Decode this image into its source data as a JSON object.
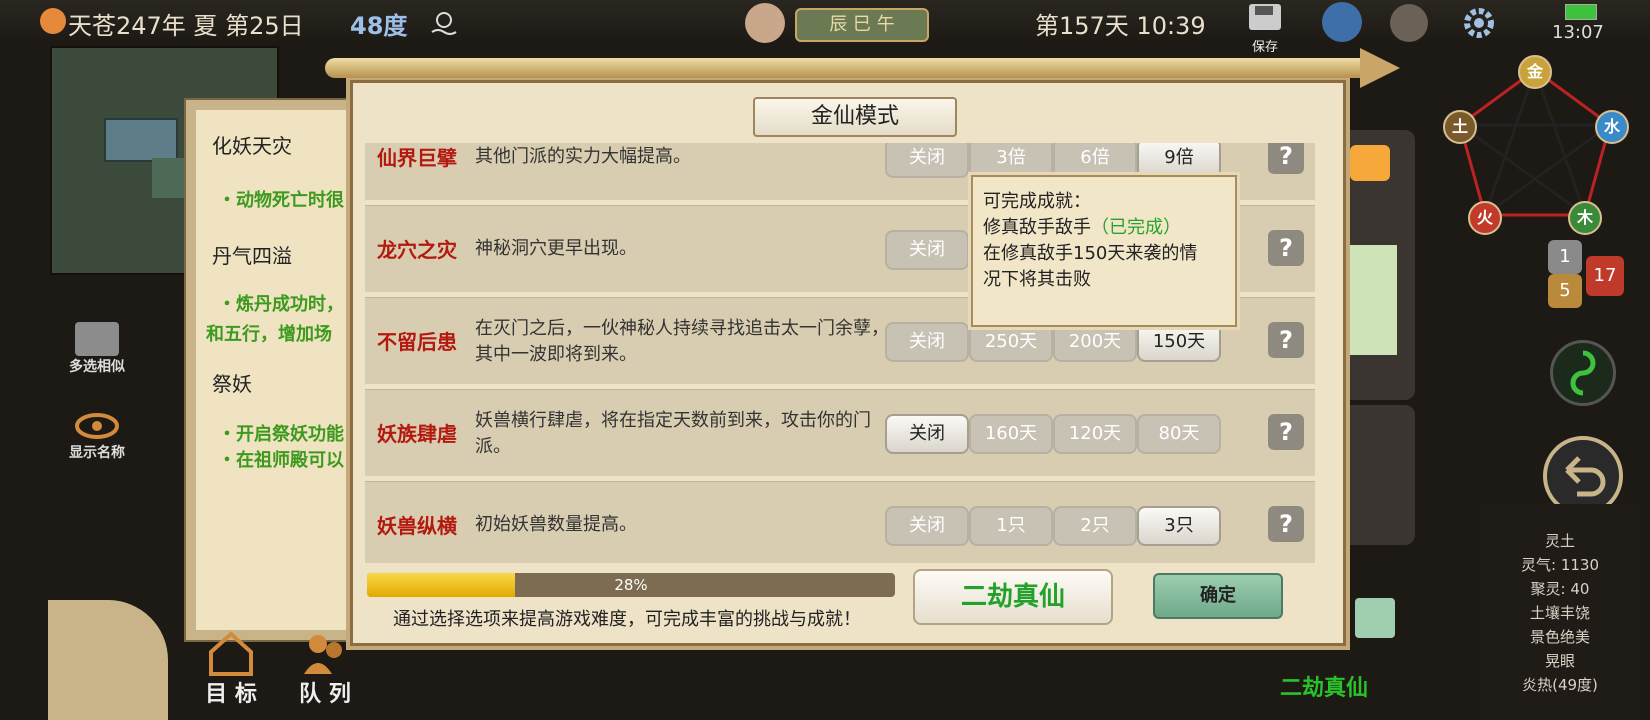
{
  "topbar": {
    "date": "天苍247年 夏 第25日",
    "temperature": "48度",
    "time_of_day": "辰 巳 午",
    "day_time": "第157天 10:39",
    "save_label": "保存",
    "clock": "13:07"
  },
  "left_panel": {
    "sections": [
      {
        "title": "化妖天灾",
        "lines": [
          "・动物死亡时很"
        ]
      },
      {
        "title": "丹气四溢",
        "lines": [
          "・炼丹成功时，",
          "和五行，增加场"
        ]
      },
      {
        "title": "祭妖",
        "lines": [
          "・开启祭妖功能",
          "・在祖师殿可以"
        ]
      }
    ]
  },
  "side_buttons": {
    "multi_select": "多选相似",
    "show_names": "显示名称",
    "goal": "目 标",
    "queue": "队 列"
  },
  "wuxing": {
    "metal": "金",
    "water": "水",
    "wood": "木",
    "fire": "火",
    "earth": "土"
  },
  "badges": {
    "one": "1",
    "five": "5",
    "seventeen": "17"
  },
  "stats": {
    "title": "灵土",
    "lines": [
      "灵气: 1130",
      "聚灵: 40",
      "土壤丰饶",
      "景色绝美",
      "晃眼",
      "炎热(49度)"
    ]
  },
  "bottom_rank_label": "二劫真仙",
  "dialog": {
    "title": "金仙模式",
    "rows": [
      {
        "name": "仙界巨擘",
        "desc": "其他门派的实力大幅提高。",
        "options": [
          "关闭",
          "3倍",
          "6倍",
          "9倍"
        ],
        "selected": 3
      },
      {
        "name": "龙穴之灾",
        "desc": "神秘洞穴更早出现。",
        "options": [
          "关闭",
          "",
          "",
          ""
        ],
        "selected": -1
      },
      {
        "name": "不留后患",
        "desc": "在灭门之后，一伙神秘人持续寻找追击太一门余孽，其中一波即将到来。",
        "options": [
          "关闭",
          "250天",
          "200天",
          "150天"
        ],
        "selected": 3
      },
      {
        "name": "妖族肆虐",
        "desc": "妖兽横行肆虐，将在指定天数前到来，攻击你的门派。",
        "options": [
          "关闭",
          "160天",
          "120天",
          "80天"
        ],
        "selected": 0
      },
      {
        "name": "妖兽纵横",
        "desc": "初始妖兽数量提高。",
        "options": [
          "关闭",
          "1只",
          "2只",
          "3只"
        ],
        "selected": 3
      }
    ],
    "help": "?",
    "tooltip": {
      "title": "可完成成就：",
      "achievement": "修真敌手敌手",
      "status": "（已完成）",
      "desc1": "在修真敌手150天来袭的情",
      "desc2": "况下将其击败"
    },
    "progress": 28,
    "progress_label": "28%",
    "footer": "通过选择选项来提高游戏难度，可完成丰富的挑战与成就！",
    "rank_button": "二劫真仙",
    "ok_button": "确定"
  }
}
